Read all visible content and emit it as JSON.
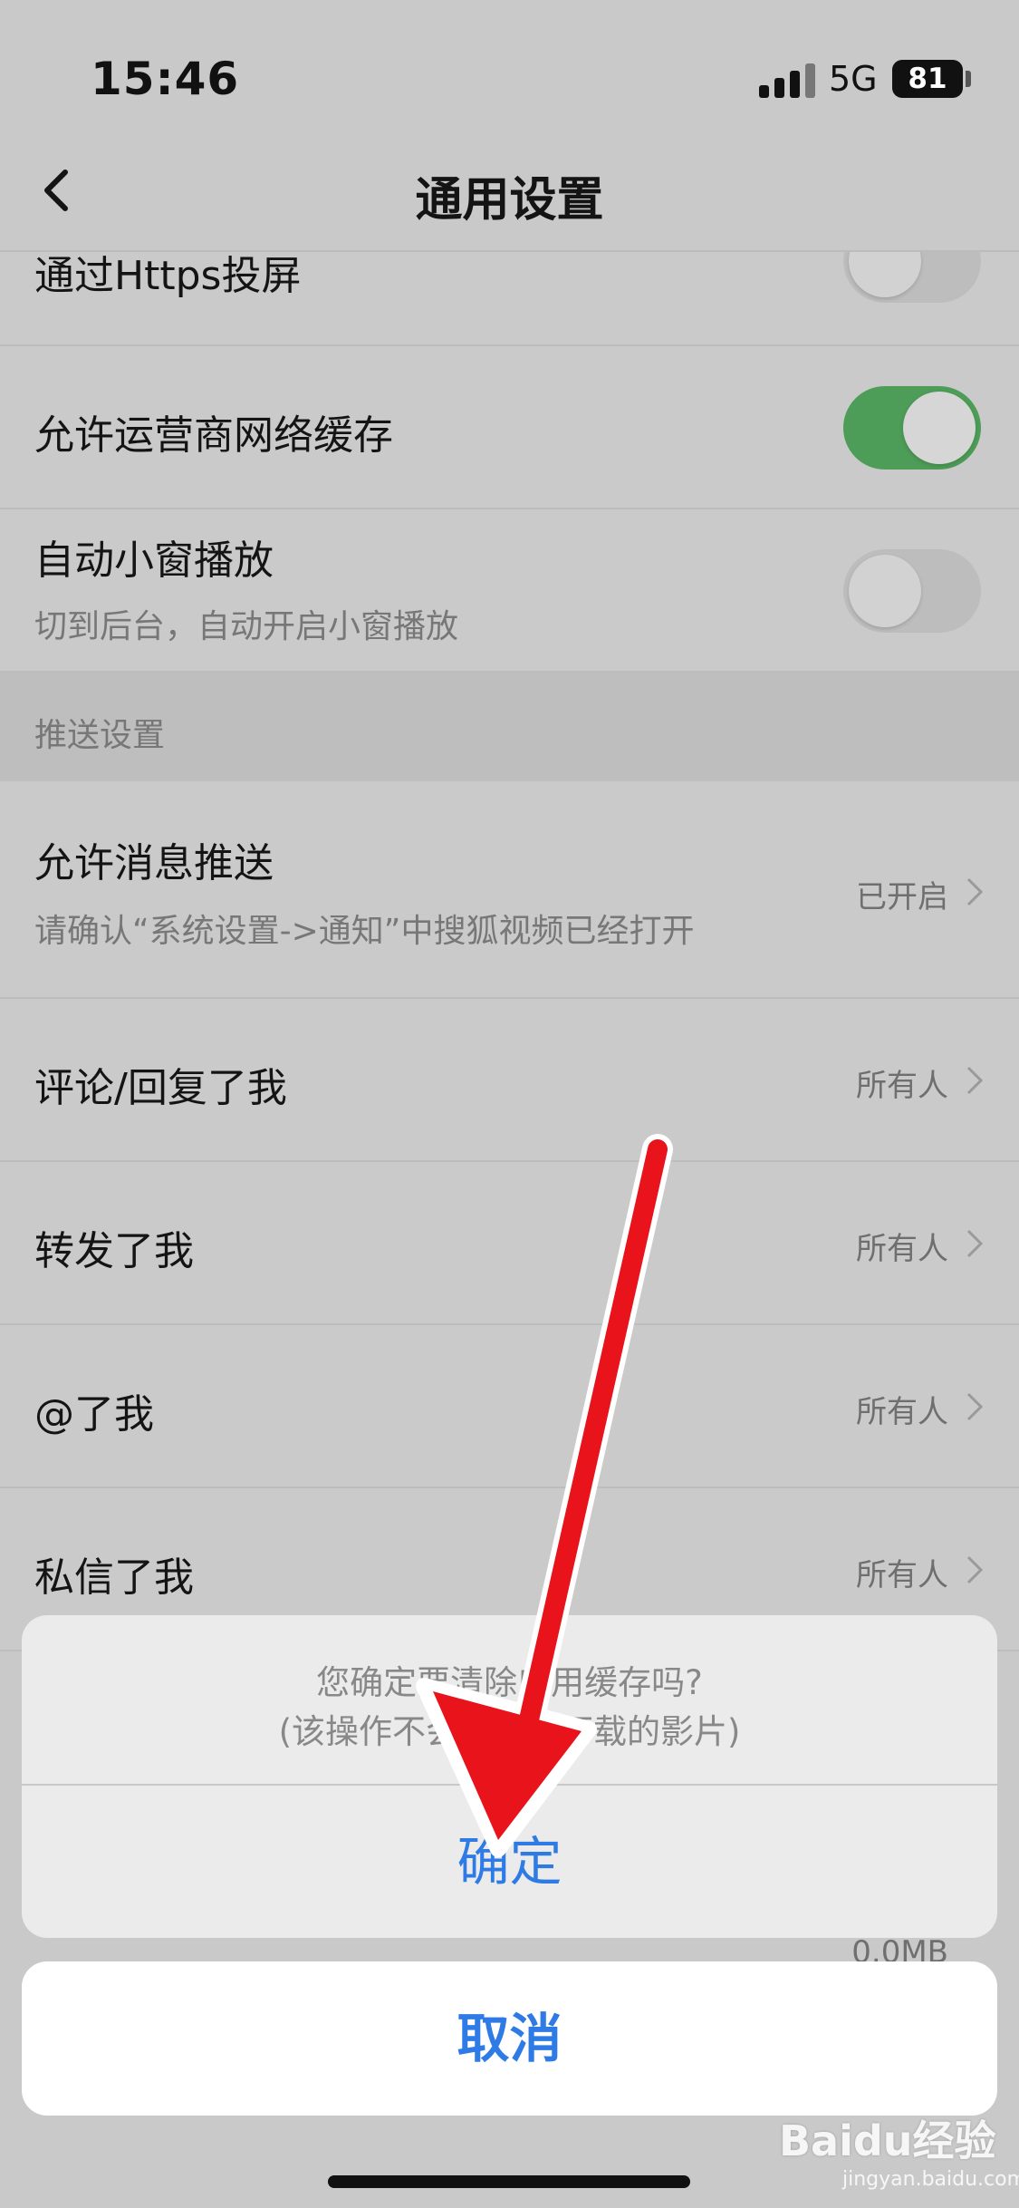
{
  "status_bar": {
    "time": "15:46",
    "network": "5G",
    "battery": "81"
  },
  "nav": {
    "title": "通用设置"
  },
  "settings": {
    "https_cast": {
      "label": "通过Https投屏",
      "enabled": false
    },
    "carrier_cache": {
      "label": "允许运营商网络缓存",
      "enabled": true
    },
    "pip": {
      "label": "自动小窗播放",
      "subtitle": "切到后台，自动开启小窗播放",
      "enabled": false
    }
  },
  "push_section": {
    "header": "推送设置",
    "items": [
      {
        "label": "允许消息推送",
        "subtitle": "请确认“系统设置->通知”中搜狐视频已经打开",
        "value": "已开启"
      },
      {
        "label": "评论/回复了我",
        "value": "所有人"
      },
      {
        "label": "转发了我",
        "value": "所有人"
      },
      {
        "label": "@了我",
        "value": "所有人"
      },
      {
        "label": "私信了我",
        "value": "所有人"
      }
    ]
  },
  "cache_size_peek": "0.0MB",
  "action_sheet": {
    "message_line1": "您确定要清除应用缓存吗?",
    "message_line2": "(该操作不会删除已下载的影片)",
    "confirm": "确定",
    "cancel": "取消"
  },
  "watermark": {
    "brand": "Baidu经验",
    "site": "jingyan.baidu.com"
  },
  "colors": {
    "accent": "#2f7be5",
    "toggle_on": "#4d9c57",
    "arrow": "#e8131b"
  }
}
